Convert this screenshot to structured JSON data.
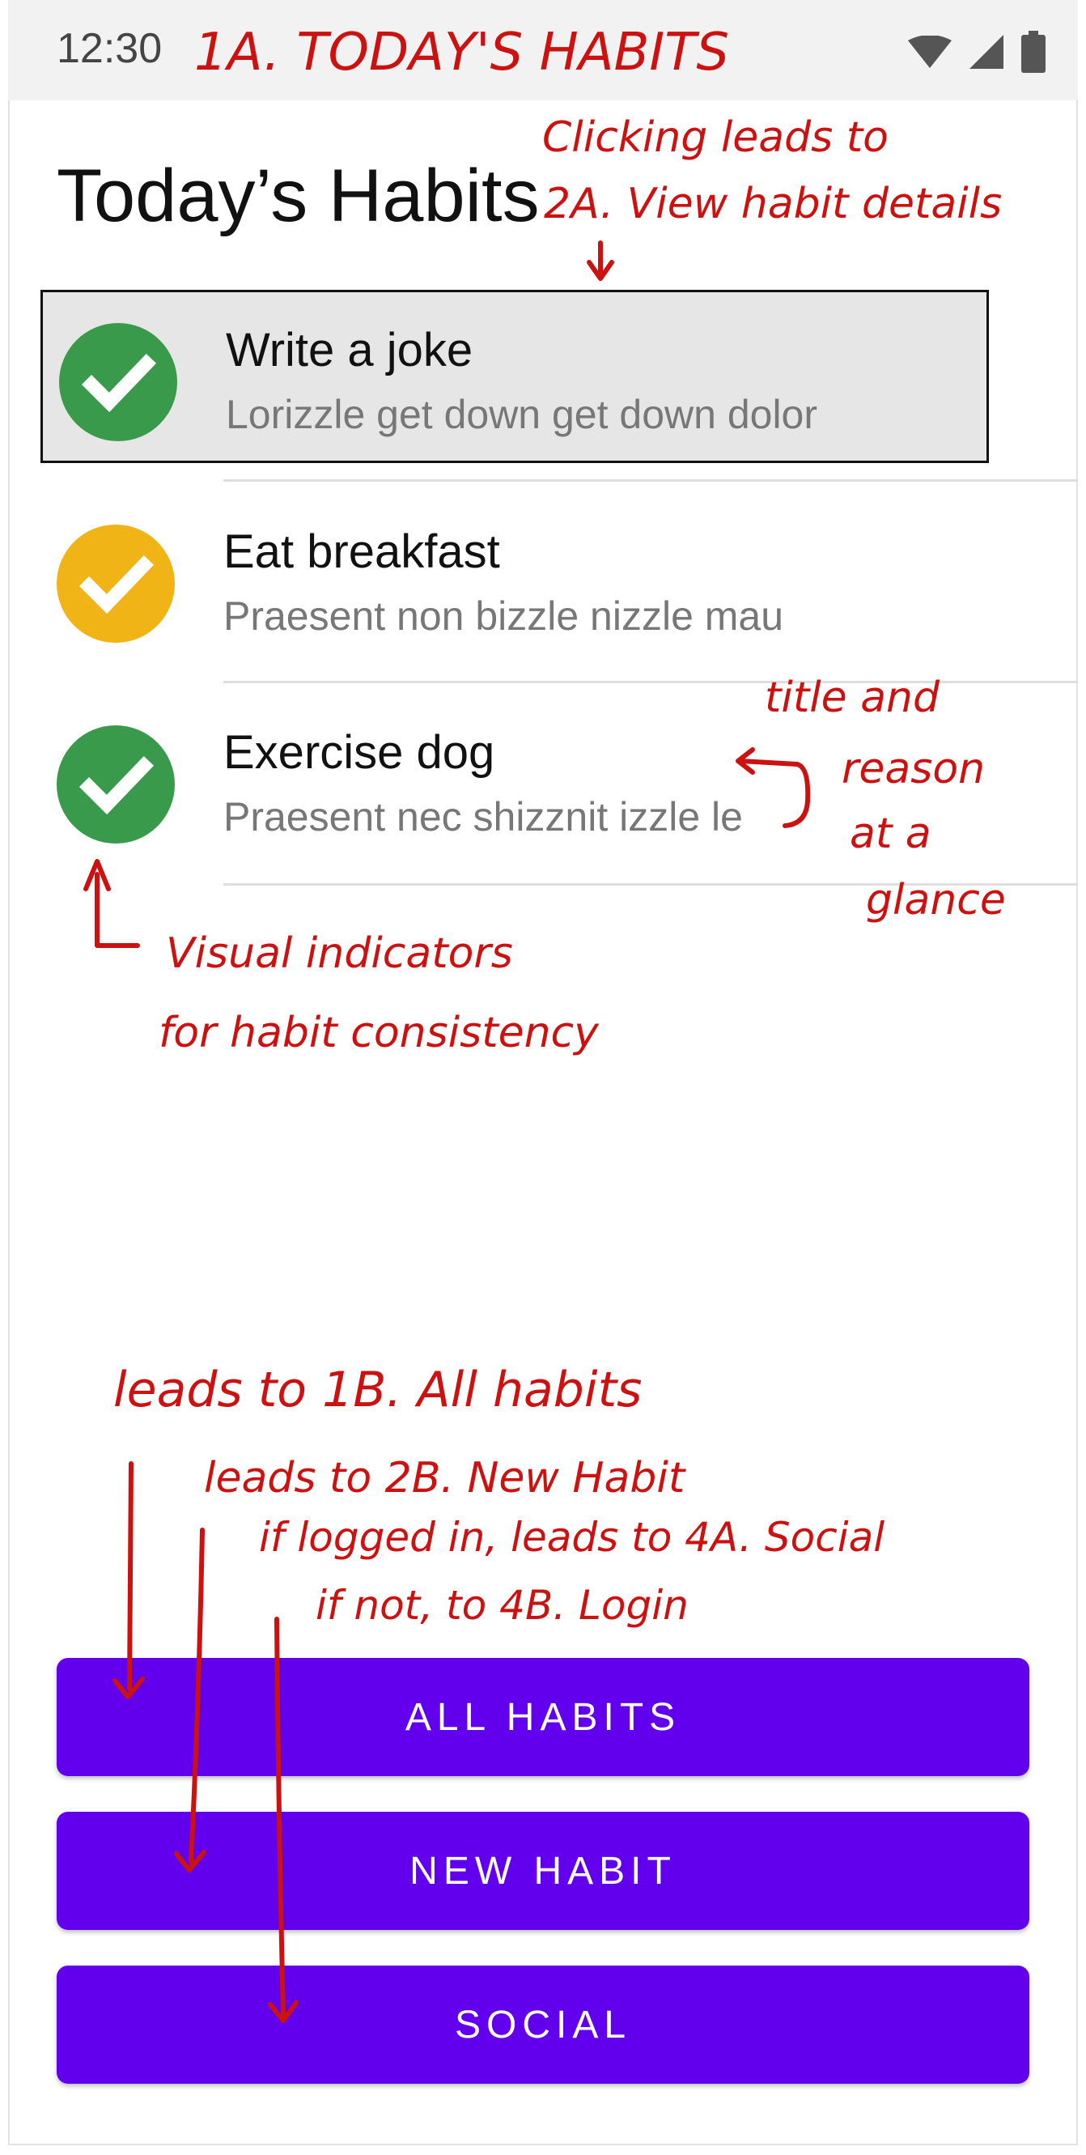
{
  "status_bar": {
    "time": "12:30",
    "icons": [
      "wifi-icon",
      "signal-icon",
      "battery-icon"
    ]
  },
  "screen_title": "Today’s Habits",
  "habits": [
    {
      "title": "Write a joke",
      "reason": "Lorizzle get down get down dolor",
      "status_color": "#3a9a4b",
      "selected": true
    },
    {
      "title": "Eat breakfast",
      "reason": "Praesent non bizzle nizzle mau",
      "status_color": "#f0b416",
      "selected": false
    },
    {
      "title": "Exercise dog",
      "reason": "Praesent nec shizznit izzle le",
      "status_color": "#3a9a4b",
      "selected": false
    }
  ],
  "buttons": {
    "all_habits": "ALL HABITS",
    "new_habit": "NEW HABIT",
    "social": "SOCIAL"
  },
  "annotations": {
    "screen_label": "1A. TODAY'S HABITS",
    "row_click_1": "Clicking leads to",
    "row_click_2": "2A. View habit details",
    "glance_1": "title and",
    "glance_2": "reason",
    "glance_3": "at a",
    "glance_4": "glance",
    "indicators_1": "Visual indicators",
    "indicators_2": "for habit consistency",
    "all_habits_note": "leads to 1B. All habits",
    "new_habit_note": "leads to 2B. New Habit",
    "social_note_1": "if logged in, leads to 4A. Social",
    "social_note_2": "if not, to 4B. Login"
  },
  "colors": {
    "accent": "#6200ee",
    "annotation": "#cc1111",
    "green": "#3a9a4b",
    "yellow": "#f0b416"
  }
}
